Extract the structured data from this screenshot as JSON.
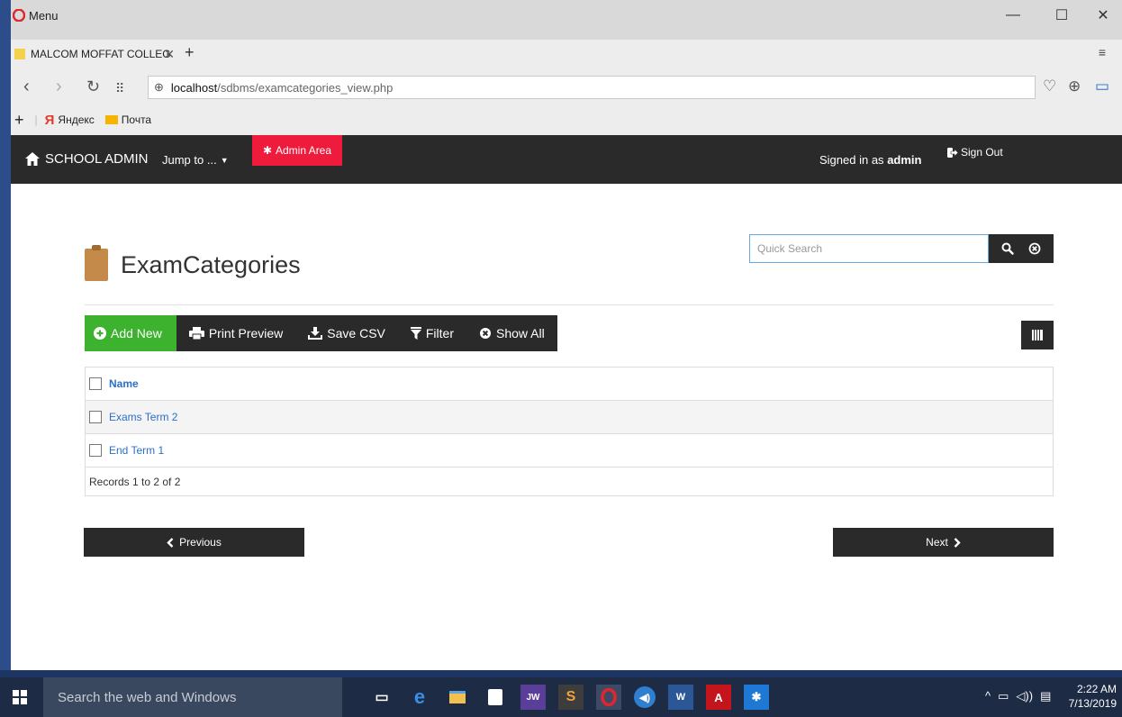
{
  "browser": {
    "menu_label": "Menu",
    "tab_title": "MALCOM MOFFAT COLLEG",
    "url_host": "localhost",
    "url_path": "/sdbms/examcategories_view.php",
    "bookmarks": [
      "Яндекс",
      "Почта"
    ]
  },
  "navbar": {
    "brand": "SCHOOL ADMIN",
    "jump_to": "Jump to ...",
    "admin_area": "Admin Area",
    "signed_in_prefix": "Signed in as",
    "signed_in_user": "admin",
    "sign_out": "Sign Out"
  },
  "page": {
    "title": "ExamCategories",
    "search_placeholder": "Quick Search"
  },
  "toolbar": {
    "add_new": "Add New",
    "print_preview": "Print Preview",
    "save_csv": "Save CSV",
    "filter": "Filter",
    "show_all": "Show All"
  },
  "table": {
    "header": "Name",
    "rows": [
      "Exams Term 2",
      "End Term 1"
    ],
    "footer": "Records 1 to 2 of 2"
  },
  "pager": {
    "previous": "Previous",
    "next": "Next"
  },
  "taskbar": {
    "search_placeholder": "Search the web and Windows",
    "time": "2:22 AM",
    "date": "7/13/2019"
  },
  "colors": {
    "navbar": "#2a2a2a",
    "admin_area": "#ee1b3d",
    "add_new": "#3db22e",
    "link": "#2a6fc9"
  }
}
